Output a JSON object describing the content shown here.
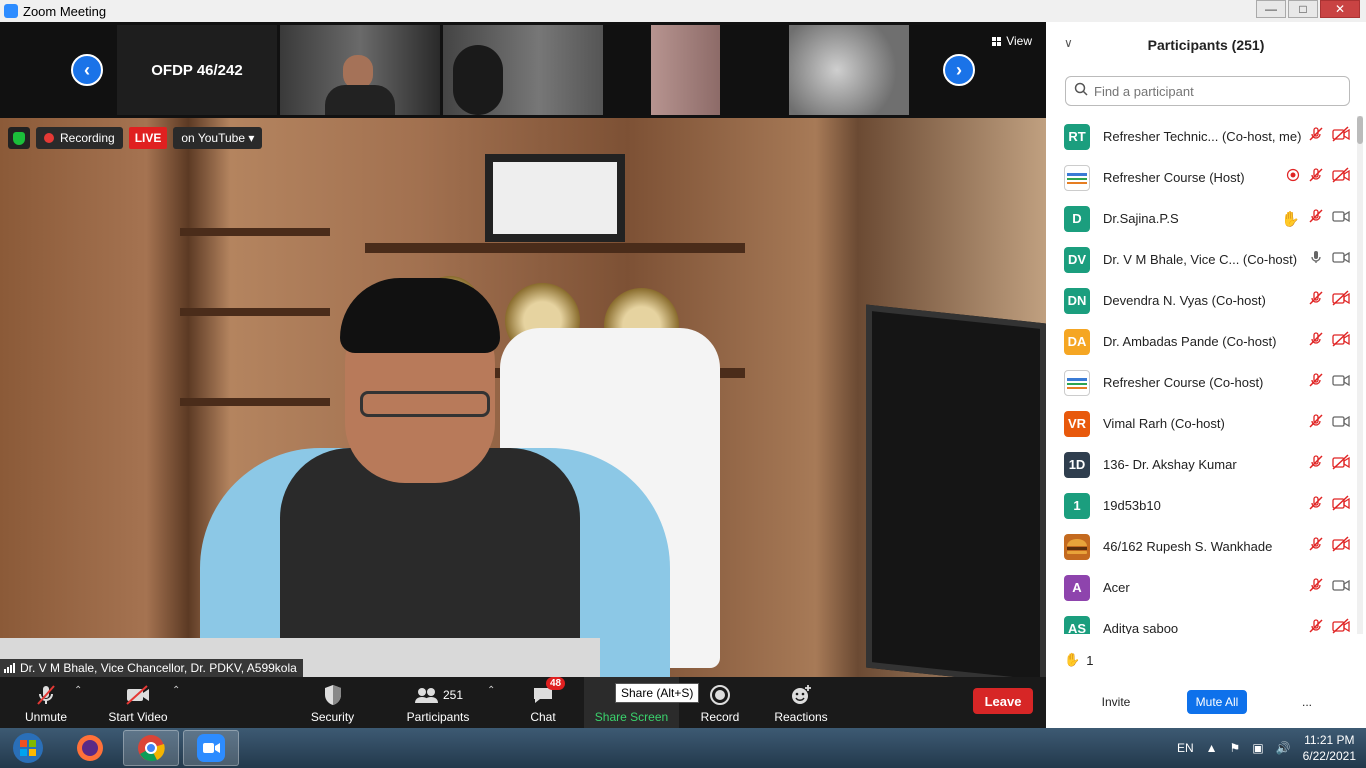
{
  "window": {
    "title": "Zoom Meeting"
  },
  "strip": {
    "tile_label": "OFDP 46/242",
    "view_label": "View"
  },
  "recording": {
    "recording_label": "Recording",
    "live_label": "LIVE",
    "stream_label": "on YouTube"
  },
  "speaker": {
    "name": "Dr. V M Bhale, Vice Chancellor, Dr. PDKV, A599kola"
  },
  "toolbar": {
    "unmute": "Unmute",
    "start_video": "Start Video",
    "security": "Security",
    "participants": "Participants",
    "participants_count": "251",
    "chat": "Chat",
    "chat_badge": "48",
    "share_screen": "Share Screen",
    "share_tooltip": "Share (Alt+S)",
    "record": "Record",
    "reactions": "Reactions",
    "leave": "Leave"
  },
  "panel": {
    "title": "Participants (251)",
    "search_placeholder": "Find a participant",
    "raised_hands": "1",
    "invite": "Invite",
    "mute_all": "Mute All",
    "more": "..."
  },
  "participants": [
    {
      "initials": "RT",
      "name": "Refresher Technic...  (Co-host, me)",
      "color": "#1b9e7e",
      "audio": "muted",
      "video": "off",
      "extra": ""
    },
    {
      "initials": "",
      "name": "Refresher Course (Host)",
      "color": "logo",
      "audio": "muted",
      "video": "off",
      "extra": "record"
    },
    {
      "initials": "D",
      "name": "Dr.Sajina.P.S",
      "color": "#1b9e7e",
      "audio": "muted",
      "video": "on",
      "extra": "hand"
    },
    {
      "initials": "DV",
      "name": "Dr. V M Bhale, Vice C...  (Co-host)",
      "color": "#1b9e7e",
      "audio": "on",
      "video": "on",
      "extra": ""
    },
    {
      "initials": "DN",
      "name": "Devendra N. Vyas (Co-host)",
      "color": "#1b9e7e",
      "audio": "muted",
      "video": "off",
      "extra": ""
    },
    {
      "initials": "DA",
      "name": "Dr. Ambadas Pande (Co-host)",
      "color": "#f5a623",
      "audio": "muted",
      "video": "off",
      "extra": ""
    },
    {
      "initials": "",
      "name": "Refresher Course (Co-host)",
      "color": "logo",
      "audio": "muted",
      "video": "on",
      "extra": ""
    },
    {
      "initials": "VR",
      "name": "Vimal Rarh (Co-host)",
      "color": "#e8590c",
      "audio": "muted",
      "video": "on",
      "extra": ""
    },
    {
      "initials": "1D",
      "name": "136- Dr. Akshay Kumar",
      "color": "#2f3e4e",
      "audio": "muted",
      "video": "off",
      "extra": ""
    },
    {
      "initials": "1",
      "name": "19d53b10",
      "color": "#1b9e7e",
      "audio": "muted",
      "video": "off",
      "extra": ""
    },
    {
      "initials": "",
      "name": "46/162 Rupesh S. Wankhade",
      "color": "burger",
      "audio": "muted",
      "video": "off",
      "extra": ""
    },
    {
      "initials": "A",
      "name": "Acer",
      "color": "#8e44ad",
      "audio": "muted",
      "video": "on",
      "extra": ""
    },
    {
      "initials": "AS",
      "name": "Aditya saboo",
      "color": "#1b9e7e",
      "audio": "muted",
      "video": "off",
      "extra": ""
    }
  ],
  "taskbar": {
    "lang": "EN",
    "time": "11:21 PM",
    "date": "6/22/2021"
  }
}
